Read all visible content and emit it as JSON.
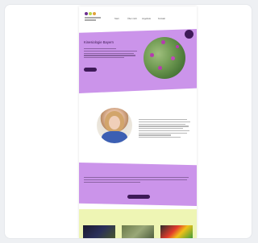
{
  "header": {
    "logo_alt": "logo",
    "nav": [
      "Start",
      "Über mich",
      "Angebote",
      "Kontakt"
    ],
    "contact_lines": [
      "",
      ""
    ]
  },
  "hero": {
    "title": "Kinesiologie Bayern",
    "button_label": "",
    "badge": ""
  },
  "about": {
    "title": "",
    "signature": ""
  },
  "pricing": {
    "title": "",
    "button_label": ""
  },
  "services": {
    "title": "",
    "items": [
      {
        "label": ""
      },
      {
        "label": ""
      },
      {
        "label": ""
      }
    ]
  },
  "colors": {
    "accent": "#cb94ea",
    "dark": "#3e1a58",
    "services_bg": "#eef5b4"
  }
}
